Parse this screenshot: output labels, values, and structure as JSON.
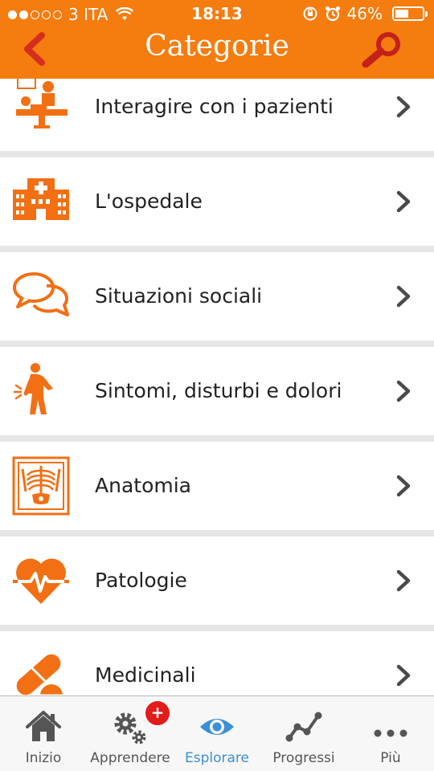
{
  "status_bar": {
    "carrier": "3 ITA",
    "time": "18:13",
    "battery": "46%",
    "battery_level": 0.46,
    "signal_bars_filled": 2,
    "signal_bars_total": 5
  },
  "header": {
    "title": "Categorie",
    "back_icon": "chevron-left-icon",
    "search_icon": "magnifier-icon"
  },
  "categories": [
    {
      "label": "Interagire con i pazienti",
      "icon": "dentist-patient-icon"
    },
    {
      "label": "L'ospedale",
      "icon": "hospital-building-icon"
    },
    {
      "label": "Situazioni sociali",
      "icon": "speech-bubbles-icon"
    },
    {
      "label": "Sintomi, disturbi e dolori",
      "icon": "person-pain-icon"
    },
    {
      "label": "Anatomia",
      "icon": "xray-skeleton-icon"
    },
    {
      "label": "Patologie",
      "icon": "heart-pulse-icon"
    },
    {
      "label": "Medicinali",
      "icon": "pills-icon"
    }
  ],
  "tabbar": {
    "tabs": [
      {
        "label": "Inizio",
        "icon": "home-icon"
      },
      {
        "label": "Apprendere",
        "icon": "gears-icon"
      },
      {
        "label": "Esplorare",
        "icon": "eye-icon"
      },
      {
        "label": "Progressi",
        "icon": "progress-chart-icon"
      },
      {
        "label": "Più",
        "icon": "more-dots-icon"
      }
    ],
    "active": "Esplorare",
    "badge": "+"
  },
  "colors": {
    "accent": "#f57c0f",
    "icon_orange": "#f26f14",
    "back_red": "#d62e1e",
    "active_tab": "#3a8fd9",
    "badge": "#e21b1b"
  }
}
